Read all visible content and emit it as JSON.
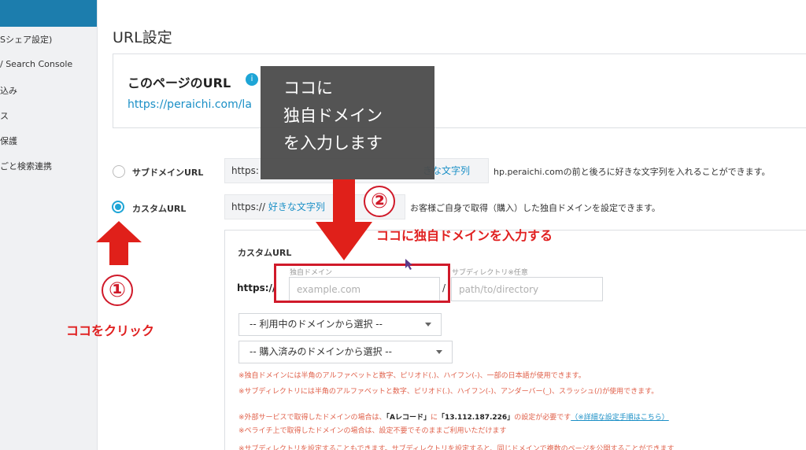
{
  "sidebar": {
    "items": [
      {
        "label": "Sシェア設定)"
      },
      {
        "label": "/ Search Console"
      },
      {
        "label": "込み"
      },
      {
        "label": "ス"
      },
      {
        "label": "保護"
      },
      {
        "label": "ごと検索連携"
      }
    ]
  },
  "header": {
    "title": "URL設定"
  },
  "url_card": {
    "title": "このページのURL",
    "badge": "i",
    "url": "https://peraichi.com/la"
  },
  "subdomain_option": {
    "label": "サブドメインURL",
    "prefix": "https:",
    "keyword": "きな文字列",
    "description": "hp.peraichi.comの前と後ろに好きな文字列を入れることができます。"
  },
  "custom_option": {
    "label": "カスタムURL",
    "prefix": "https://",
    "keyword": "好きな文字列",
    "description": "お客様ご自身で取得（購入）した独自ドメインを設定できます。"
  },
  "custom_panel": {
    "title": "カスタムURL",
    "scheme_label": "https://",
    "domain_label": "独自ドメイン",
    "domain_placeholder": "example.com",
    "separator": "/",
    "path_label": "サブディレクトリ※任意",
    "path_placeholder": "path/to/directory",
    "select_in_use": "-- 利用中のドメインから選択 --",
    "select_purchased": "-- 購入済みのドメインから選択 --",
    "note_domain_chars": "※独自ドメインには半角のアルファベットと数字、ピリオド(.)、ハイフン(-)、一部の日本語が使用できます。",
    "note_subdir_chars": "※サブディレクトリには半角のアルファベットと数字、ピリオド(.)、ハイフン(-)、アンダーバー(_)、スラッシュ(/)が使用できます。",
    "note_external_a": "※外部サービスで取得したドメインの場合は、",
    "note_external_record": "「Aレコード」",
    "note_external_b": "に",
    "note_external_ip": "「13.112.187.226」",
    "note_external_c": "の設定が必要です",
    "note_external_link": "（※詳細な設定手順はこちら）",
    "note_peraichi": "※ペライチ上で取得したドメインの場合は、設定不要でそのままご利用いただけます",
    "note_cutoff": "※サブディレクトリを設定することもできます。サブディレクトリを設定すると、同じドメインで複数のページを公開することができます"
  },
  "annotations": {
    "tooltip_lines": [
      "ココに",
      "独自ドメイン",
      "を入力します"
    ],
    "step1_number": "①",
    "step1_text": "ココをクリック",
    "step2_number": "②",
    "step2_text": "ココに独自ドメインを入力する",
    "accent_color": "#d01a2a"
  }
}
